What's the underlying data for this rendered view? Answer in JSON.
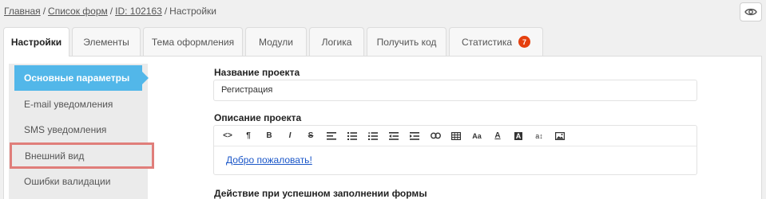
{
  "breadcrumb": {
    "home": "Главная",
    "forms": "Список форм",
    "id": "ID: 102163",
    "current": "Настройки",
    "separator": "/"
  },
  "tabs": [
    {
      "label": "Настройки",
      "active": true
    },
    {
      "label": "Элементы"
    },
    {
      "label": "Тема оформления"
    },
    {
      "label": "Модули"
    },
    {
      "label": "Логика"
    },
    {
      "label": "Получить код"
    },
    {
      "label": "Статистика",
      "badge": "7"
    }
  ],
  "sidebar": {
    "items": [
      {
        "label": "Основные параметры",
        "active": true
      },
      {
        "label": "E-mail уведомления"
      },
      {
        "label": "SMS уведомления"
      },
      {
        "label": "Внешний вид",
        "highlighted": true
      },
      {
        "label": "Ошибки валидации"
      }
    ]
  },
  "main": {
    "project_name_label": "Название проекта",
    "project_name_value": "Регистрация",
    "description_label": "Описание проекта",
    "toolbar": {
      "code": "<>",
      "paragraph": "¶",
      "bold": "B",
      "italic": "I",
      "strike": "S",
      "font_size": "Aa",
      "text_color": "A",
      "bg_color": "A",
      "line_height": "a↕"
    },
    "description_link": "Добро пожаловать!",
    "success_action_label": "Действие при успешном заполнении формы"
  },
  "colors": {
    "accent": "#52b7e9",
    "badge": "#e5400e",
    "highlight_border": "#e07e7a",
    "link": "#1a56c8"
  },
  "icons": {
    "view": "eye-icon"
  }
}
